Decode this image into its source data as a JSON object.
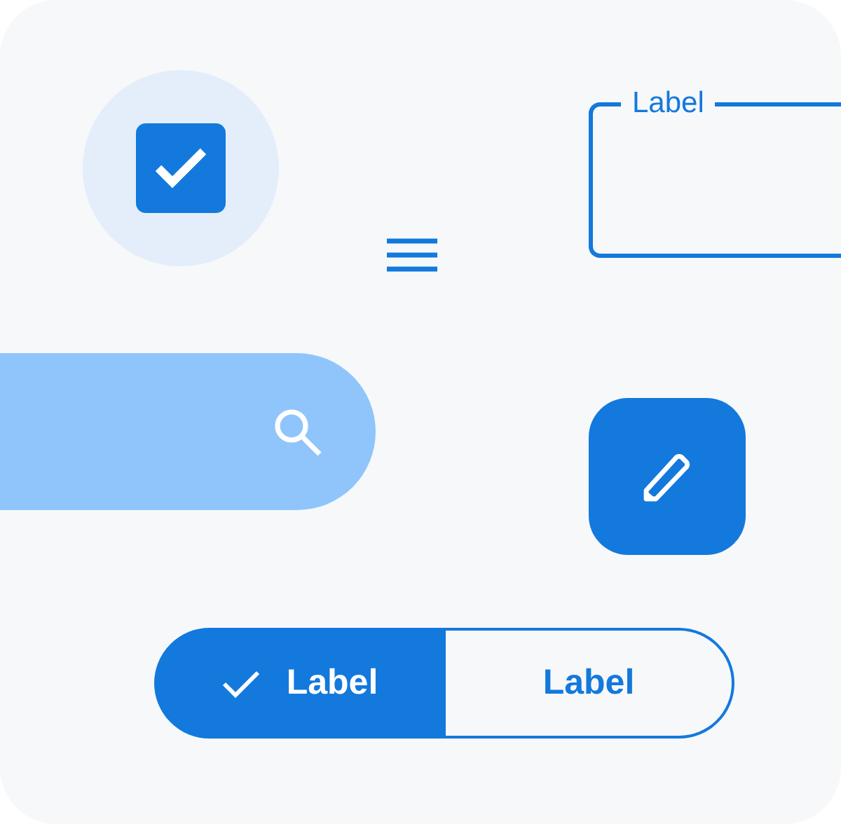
{
  "checkbox": {
    "checked": true
  },
  "text_field": {
    "label": "Label"
  },
  "segmented_buttons": [
    {
      "label": "Label",
      "selected": true
    },
    {
      "label": "Label",
      "selected": false
    }
  ]
}
